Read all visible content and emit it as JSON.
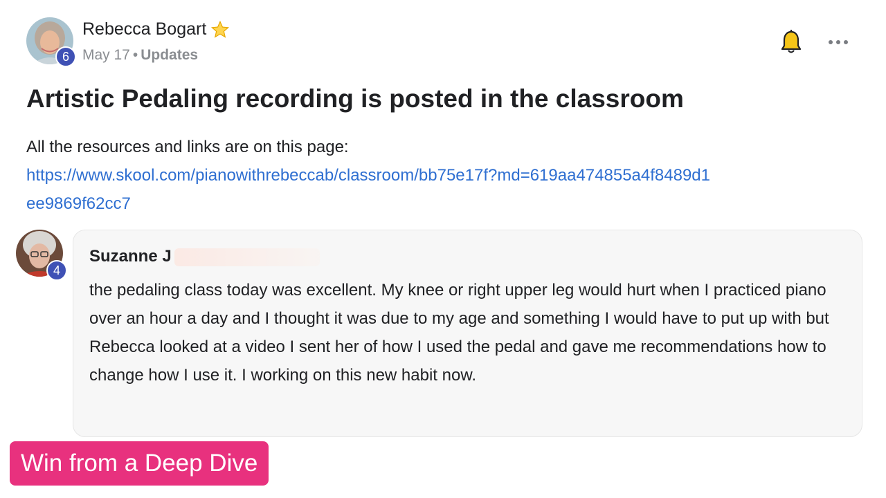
{
  "post": {
    "author_name": "Rebecca Bogart",
    "author_level": "6",
    "date": "May 17",
    "separator": "•",
    "category": "Updates",
    "title": "Artistic Pedaling recording is posted in the classroom",
    "body_intro": "All the resources and links are on this page:",
    "link_text": "https://www.skool.com/pianowithrebeccab/classroom/bb75e17f?md=619aa474855a4f8489d1ee9869f62cc7"
  },
  "icons": {
    "star": "star-icon",
    "bell": "bell-icon",
    "more": "more-icon"
  },
  "comment": {
    "author_name": "Suzanne J",
    "author_level": "4",
    "text": "the pedaling class today was excellent. My knee or right upper leg would hurt when I practiced piano over an hour a day and I thought it was due to my age and something I would have to put up with but Rebecca looked at a video I sent her of how I used the pedal and gave me recommendations how to change how I use it. I working on this new habit now."
  },
  "banner": {
    "label": "Win from a Deep Dive"
  },
  "colors": {
    "link": "#2f6fd1",
    "level_badge": "#3f51b5",
    "banner": "#e8317e",
    "bell": "#f5c518"
  }
}
